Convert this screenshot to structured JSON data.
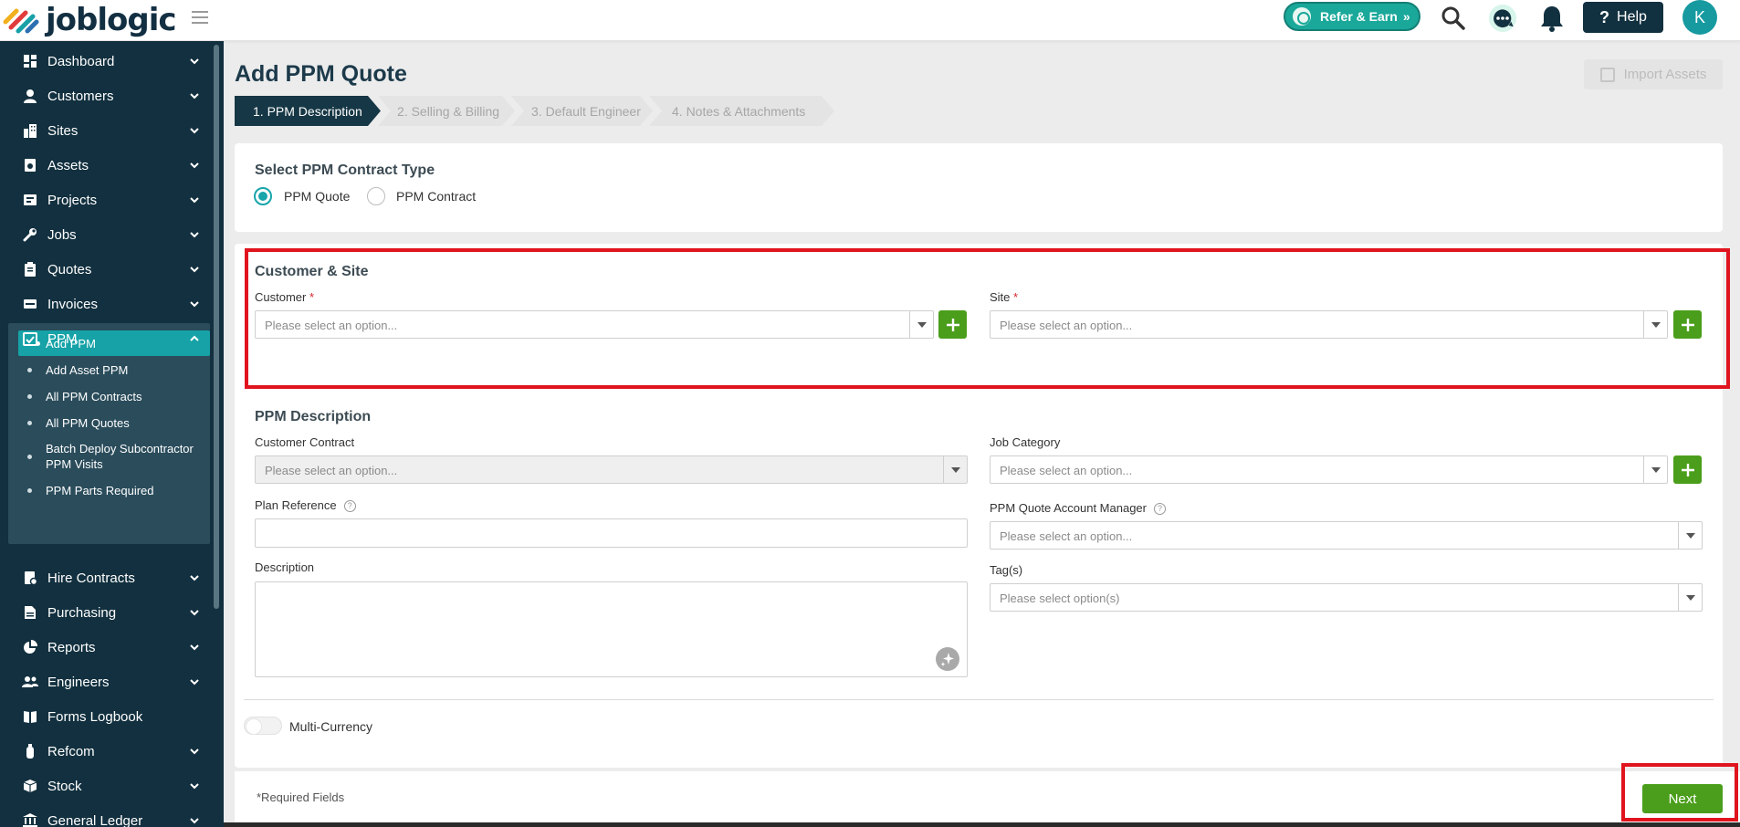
{
  "app": {
    "logo_text": "joblogic"
  },
  "header": {
    "refer_label": "Refer & Earn",
    "help_label": "Help",
    "avatar_initial": "K",
    "icons": [
      "search-icon",
      "chat-icon",
      "bell-icon"
    ]
  },
  "sidebar": {
    "items": [
      {
        "label": "Dashboard",
        "icon": "dashboard-icon"
      },
      {
        "label": "Customers",
        "icon": "user-icon"
      },
      {
        "label": "Sites",
        "icon": "building-icon"
      },
      {
        "label": "Assets",
        "icon": "asset-icon"
      },
      {
        "label": "Projects",
        "icon": "projects-icon"
      },
      {
        "label": "Jobs",
        "icon": "wrench-icon"
      },
      {
        "label": "Quotes",
        "icon": "clipboard-icon"
      },
      {
        "label": "Invoices",
        "icon": "invoice-icon"
      },
      {
        "label": "PPM",
        "icon": "calendar-check-icon"
      },
      {
        "label": "Hire Contracts",
        "icon": "contract-icon"
      },
      {
        "label": "Purchasing",
        "icon": "document-icon"
      },
      {
        "label": "Reports",
        "icon": "pie-chart-icon"
      },
      {
        "label": "Engineers",
        "icon": "users-icon"
      },
      {
        "label": "Forms Logbook",
        "icon": "book-icon"
      },
      {
        "label": "Refcom",
        "icon": "cylinder-icon"
      },
      {
        "label": "Stock",
        "icon": "box-icon"
      },
      {
        "label": "General Ledger",
        "icon": "bank-icon"
      }
    ],
    "ppm_sub": [
      {
        "label": "Add PPM"
      },
      {
        "label": "Add Asset PPM"
      },
      {
        "label": "All PPM Contracts"
      },
      {
        "label": "All PPM Quotes"
      },
      {
        "label": "Batch Deploy Subcontractor PPM Visits"
      },
      {
        "label": "PPM Parts Required"
      }
    ]
  },
  "page": {
    "title": "Add PPM Quote",
    "import_label": "Import Assets",
    "steps": [
      {
        "label": "1. PPM Description",
        "active": true
      },
      {
        "label": "2. Selling & Billing",
        "active": false
      },
      {
        "label": "3. Default Engineer",
        "active": false
      },
      {
        "label": "4. Notes & Attachments",
        "active": false
      }
    ]
  },
  "contract_type": {
    "title": "Select PPM Contract Type",
    "options": [
      {
        "label": "PPM Quote",
        "selected": true
      },
      {
        "label": "PPM Contract",
        "selected": false
      }
    ]
  },
  "customer_site": {
    "title": "Customer & Site",
    "customer_label": "Customer",
    "site_label": "Site",
    "required_mark": "*",
    "placeholder": "Please select an option..."
  },
  "ppm_description": {
    "title": "PPM Description",
    "customer_contract_label": "Customer Contract",
    "job_category_label": "Job Category",
    "plan_reference_label": "Plan Reference",
    "account_manager_label": "PPM Quote Account Manager",
    "description_label": "Description",
    "tags_label": "Tag(s)",
    "placeholder": "Please select an option...",
    "tags_placeholder": "Please select option(s)",
    "help_glyph": "?"
  },
  "multi_currency": {
    "label": "Multi-Currency",
    "on": false
  },
  "footer": {
    "required_note": "*Required Fields",
    "next_label": "Next"
  },
  "colors": {
    "sidebar_bg": "#12303f",
    "accent_teal": "#17a5aa",
    "button_green": "#4b9e1b",
    "highlight_red": "#e0141e"
  }
}
